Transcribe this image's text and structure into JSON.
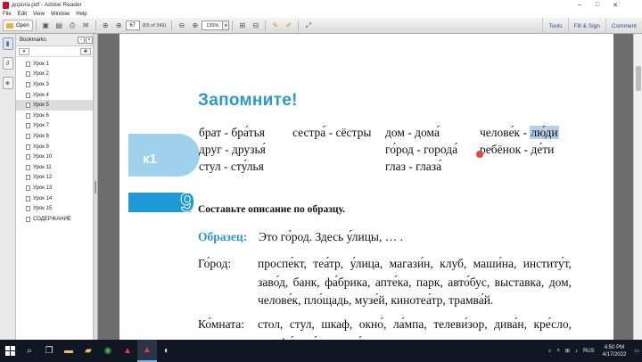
{
  "window": {
    "title": "дорога.pdf - Adobe Reader"
  },
  "menu": [
    "File",
    "Edit",
    "View",
    "Window",
    "Help"
  ],
  "toolbar": {
    "open_label": "Open",
    "page_number": "67",
    "page_count": "(65 of 343)",
    "zoom": "135%",
    "right_items": [
      "Tools",
      "Fill & Sign",
      "Comment"
    ]
  },
  "bookmarks": {
    "title": "Bookmarks",
    "items": [
      "Урок 1",
      "Урок 2",
      "Урок 3",
      "Урок 4",
      "Урок 5",
      "Урок 6",
      "Урок 7",
      "Урок 8",
      "Урок 9",
      "Урок 10",
      "Урок 11",
      "Урок 12",
      "Урок 13",
      "Урок 14",
      "Урок 15",
      "СОДЕРЖАНИЕ"
    ],
    "selected_index": 4
  },
  "page": {
    "heading": "Запомните!",
    "badge": "к1",
    "word_columns": [
      [
        "брат - бра́тья",
        "друг - друзья́",
        "стул - сту́лья"
      ],
      [
        "сестра́ - сёстры"
      ],
      [
        "дом - дома́",
        "го́род - города́",
        "глаз - глаза́"
      ],
      [
        "челове́к - ",
        "ребёнок - де́ти"
      ]
    ],
    "highlight_word": "лю́ди",
    "exercise_number": "9",
    "exercise_title": "Составьте описание по образцу.",
    "sample_label": "Образец:",
    "sample_text": "Это го́род. Здесь у́лицы, … .",
    "gorod_label": "Го́род:",
    "gorod_text": "проспе́кт, теа́тр, у́лица, магази́н, клуб, маши́на, институ́т, заво́д, банк, фа́брика, апте́ка, парк, авто́бус, выставка, дом, челове́к, пло́щадь, музе́й, кинотеа́тр, трамва́й.",
    "komnata_label": "Ко́мната:",
    "komnata_text": "стол, стул, шкаф, окно́, ла́мпа, телеви́зор, дива́н, кре́сло, телефо́н, ва́за, карти́на,"
  },
  "taskbar": {
    "lang": "RUS",
    "time": "4:50 PM",
    "date": "4/17/2022"
  }
}
